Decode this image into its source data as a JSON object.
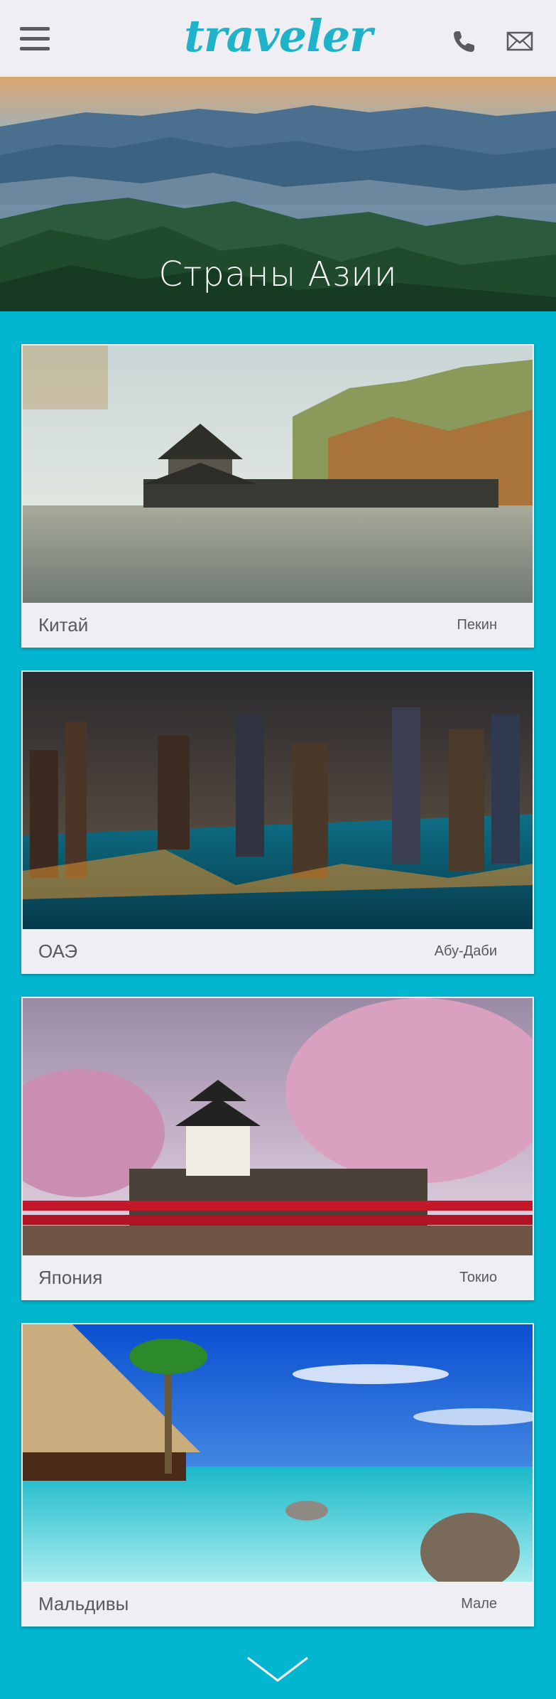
{
  "header": {
    "logo": "traveler",
    "icons": [
      "menu-icon",
      "phone-icon",
      "mail-icon"
    ]
  },
  "hero": {
    "title": "Страны Азии"
  },
  "cards": [
    {
      "country": "Китай",
      "city": "Пекин",
      "image": "china-pagoda-lake-photo"
    },
    {
      "country": "ОАЭ",
      "city": "Абу-Даби",
      "image": "uae-night-city-marina-photo"
    },
    {
      "country": "Япония",
      "city": "Токио",
      "image": "japan-castle-sakura-photo"
    },
    {
      "country": "Мальдивы",
      "city": "Мале",
      "image": "maldives-beach-bungalow-photo"
    }
  ],
  "footer": {
    "scroll_icon": "chevron-down-icon"
  },
  "colors": {
    "background": "#02b6cf",
    "header": "#efeff3",
    "logo": "#1fb3c9",
    "card": "#eeeef3",
    "text": "#58585e"
  }
}
